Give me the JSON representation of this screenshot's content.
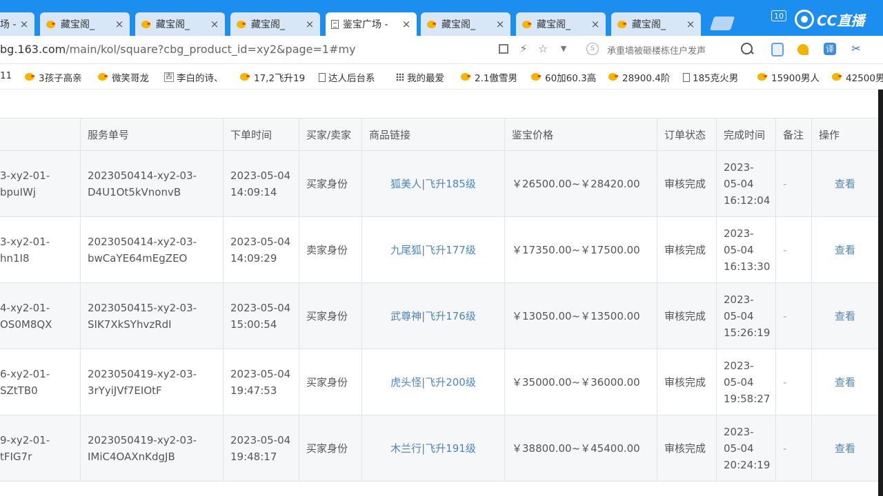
{
  "browser": {
    "tabs": [
      {
        "title": "场 -",
        "icon": "none",
        "active": false
      },
      {
        "title": "藏宝阁_",
        "icon": "chick",
        "active": false
      },
      {
        "title": "藏宝阁_",
        "icon": "chick",
        "active": false
      },
      {
        "title": "藏宝阁_",
        "icon": "chick",
        "active": false
      },
      {
        "title": "鉴宝广场 -",
        "icon": "doc",
        "active": true
      },
      {
        "title": "藏宝阁_",
        "icon": "chick",
        "active": false
      },
      {
        "title": "藏宝阁_",
        "icon": "chick",
        "active": false
      },
      {
        "title": "藏宝阁_",
        "icon": "chick",
        "active": false
      }
    ],
    "tab_close": "×",
    "tab_badge": "10",
    "brand": "CC直播",
    "url_host": "bg.163.com",
    "url_rest": "/main/kol/square?cbg_product_id=xy2&page=1#my",
    "search_text": "承重墙被砸楼栋住户发声",
    "search_s": "S",
    "bookmarks": [
      {
        "label": "11",
        "icon": "none"
      },
      {
        "label": "3孩子高亲",
        "icon": "chick"
      },
      {
        "label": "微笑哥龙",
        "icon": "chick"
      },
      {
        "label": "李白的诗、",
        "icon": "ancient"
      },
      {
        "label": "17,2飞升19",
        "icon": "chick"
      },
      {
        "label": "达人后台系",
        "icon": "doc"
      },
      {
        "label": "我的最爱",
        "icon": "grid"
      },
      {
        "label": "2.1傲雪男",
        "icon": "chick"
      },
      {
        "label": "60加60.3高",
        "icon": "chick"
      },
      {
        "label": "28900.4阶",
        "icon": "chick"
      },
      {
        "label": "185克火男",
        "icon": "doc"
      },
      {
        "label": "15900男人",
        "icon": "chick"
      },
      {
        "label": "42500男",
        "icon": "chick"
      }
    ],
    "ancient_glyph": "古"
  },
  "table": {
    "headers": [
      "服务单号",
      "下单时间",
      "买家/卖家",
      "商品链接",
      "鉴宝价格",
      "订单状态",
      "完成时间",
      "备注",
      "操作"
    ],
    "rows": [
      {
        "order_prefix_1": "3-xy2-01-",
        "order_prefix_2": "bpuIWj",
        "service_1": "2023050414-xy2-03-",
        "service_2": "D4U1Ot5kVnonvB",
        "time_1": "2023-05-04",
        "time_2": "14:09:14",
        "role": "买家身份",
        "product": "狐美人|飞升185级",
        "price": "￥26500.00~￥28420.00",
        "status": "审核完成",
        "done_1": "2023-",
        "done_2": "05-04",
        "done_3": "16:12:04",
        "note": "-",
        "action": "查看"
      },
      {
        "order_prefix_1": "3-xy2-01-",
        "order_prefix_2": "hn1I8",
        "service_1": "2023050414-xy2-03-",
        "service_2": "bwCaYE64mEgZEO",
        "time_1": "2023-05-04",
        "time_2": "14:09:29",
        "role": "卖家身份",
        "product": "九尾狐|飞升177级",
        "price": "￥17350.00~￥17500.00",
        "status": "审核完成",
        "done_1": "2023-",
        "done_2": "05-04",
        "done_3": "16:13:30",
        "note": "-",
        "action": "查看"
      },
      {
        "order_prefix_1": "4-xy2-01-",
        "order_prefix_2": "OS0M8QX",
        "service_1": "2023050415-xy2-03-",
        "service_2": "SIK7XkSYhvzRdI",
        "time_1": "2023-05-04",
        "time_2": "15:00:54",
        "role": "买家身份",
        "product": "武尊神|飞升176级",
        "price": "￥13050.00~￥13500.00",
        "status": "审核完成",
        "done_1": "2023-",
        "done_2": "05-04",
        "done_3": "15:26:19",
        "note": "-",
        "action": "查看"
      },
      {
        "order_prefix_1": "6-xy2-01-",
        "order_prefix_2": "SZtTB0",
        "service_1": "2023050419-xy2-03-",
        "service_2": "3rYyiJVf7EIOtF",
        "time_1": "2023-05-04",
        "time_2": "19:47:53",
        "role": "买家身份",
        "product": "虎头怪|飞升200级",
        "price": "￥35000.00~￥36000.00",
        "status": "审核完成",
        "done_1": "2023-",
        "done_2": "05-04",
        "done_3": "19:58:27",
        "note": "-",
        "action": "查看"
      },
      {
        "order_prefix_1": "9-xy2-01-",
        "order_prefix_2": "tFIG7r",
        "service_1": "2023050419-xy2-03-",
        "service_2": "IMiC4OAXnKdgJB",
        "time_1": "2023-05-04",
        "time_2": "19:48:17",
        "role": "买家身份",
        "product": "木兰行|飞升191级",
        "price": "￥38800.00~￥45400.00",
        "status": "审核完成",
        "done_1": "2023-",
        "done_2": "05-04",
        "done_3": "20:24:19",
        "note": "-",
        "action": "查看"
      }
    ]
  },
  "colors": {
    "tabstrip": "#1c8ef0",
    "link": "#4a86c6",
    "row_shade": "#f5f7f9"
  }
}
